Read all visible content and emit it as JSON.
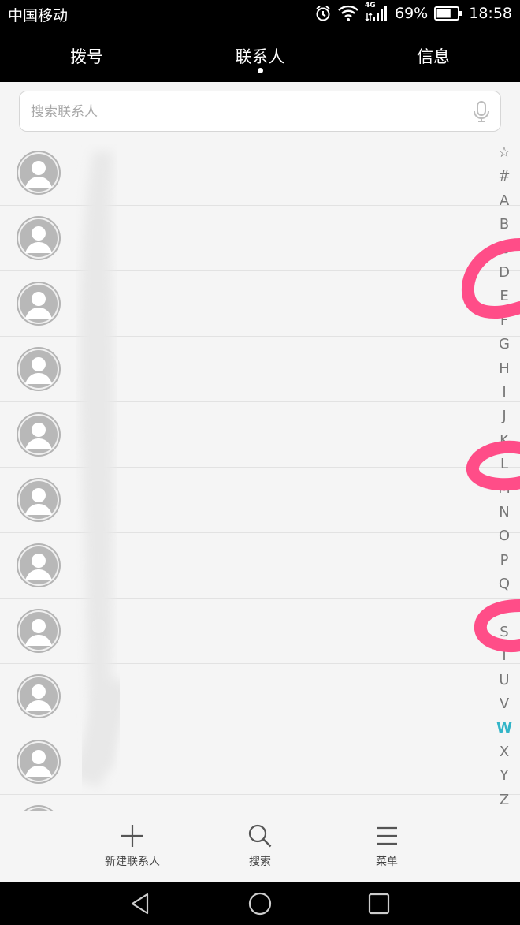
{
  "status_bar": {
    "carrier": "中国移动",
    "network": "4G",
    "battery": "69%",
    "battery_level": 0.69,
    "time": "18:58"
  },
  "tabs": [
    {
      "label": "拨号",
      "active": false
    },
    {
      "label": "联系人",
      "active": true
    },
    {
      "label": "信息",
      "active": false
    }
  ],
  "search": {
    "placeholder": "搜索联系人",
    "value": ""
  },
  "contacts": [
    {
      "name": ""
    },
    {
      "name": ""
    },
    {
      "name": ""
    },
    {
      "name": ""
    },
    {
      "name": ""
    },
    {
      "name": ""
    },
    {
      "name": ""
    },
    {
      "name": ""
    },
    {
      "name": ""
    },
    {
      "name": ""
    },
    {
      "name": ""
    }
  ],
  "alpha_index": {
    "letters": [
      "☆",
      "#",
      "A",
      "B",
      "C",
      "D",
      "E",
      "F",
      "G",
      "H",
      "I",
      "J",
      "K",
      "L",
      "M",
      "N",
      "O",
      "P",
      "Q",
      "R",
      "S",
      "T",
      "U",
      "V",
      "W",
      "X",
      "Y",
      "Z"
    ],
    "active": "W",
    "active_color": "#33b5c8"
  },
  "bottom_actions": [
    {
      "label": "新建联系人",
      "icon": "plus-icon"
    },
    {
      "label": "搜索",
      "icon": "search-icon"
    },
    {
      "label": "菜单",
      "icon": "menu-icon"
    }
  ],
  "nav": [
    "back-icon",
    "home-icon",
    "recents-icon"
  ],
  "annotation_color": "#ff4d88"
}
